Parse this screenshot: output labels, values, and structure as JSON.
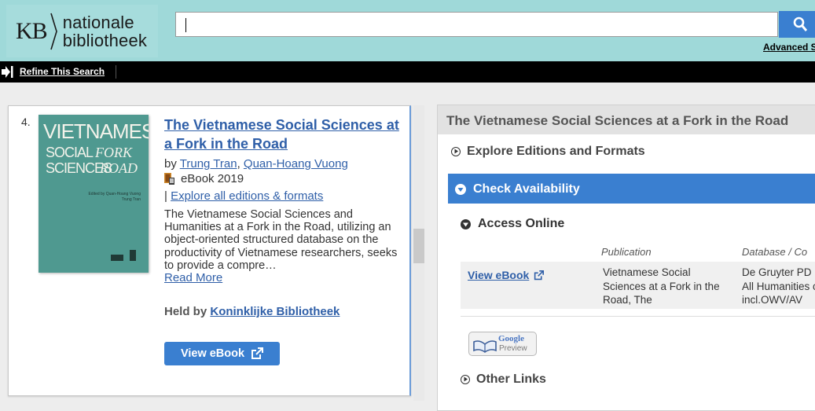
{
  "header": {
    "logo": {
      "kb": "KB",
      "line1": "nationale",
      "line2": "bibliotheek"
    },
    "search": {
      "value": "",
      "button_icon": "search-icon"
    },
    "advanced_search": "Advanced S"
  },
  "refine_bar": {
    "icon": "refine-arrow-icon",
    "label": "Refine This Search"
  },
  "record": {
    "number": "4.",
    "cover": {
      "line1": "VIETNAMESE",
      "line2": "SOCIAL",
      "line3": "SCIENCES",
      "fork": "FORK",
      "road": "ROAD",
      "small_text": "Edited by Quan-Hoang Vuong Trung Tran"
    },
    "title": "The Vietnamese Social Sciences at a Fork in the Road",
    "by_label": "by",
    "authors": [
      "Trung Tran",
      "Quan-Hoang Vuong"
    ],
    "author_sep": ",",
    "format": "eBook 2019",
    "format_icon": "ebook-icon",
    "explore_prefix": "|",
    "explore_link": "Explore all editions & formats",
    "summary": "The Vietnamese Social Sciences and Humanities at a Fork in the Road, utilizing an object-oriented structured database on the productivity of Vietnamese researchers, seeks to provide a compre…",
    "read_more": "Read More",
    "held_by_label": "Held by",
    "held_by_link": "Koninklijke Bibliotheek",
    "view_ebook": "View eBook"
  },
  "detail": {
    "title": "The Vietnamese Social Sciences at a Fork in the Road",
    "explore": "Explore Editions and Formats",
    "check_availability": "Check Availability",
    "access_online": "Access Online",
    "columns": {
      "publication": "Publication",
      "database": "Database / Co"
    },
    "row": {
      "link": "View eBook",
      "publication": "Vietnamese Social Sciences at a Fork in the Road, The",
      "database_line1": "De Gruyter PD",
      "database_line2": "All Humanities c",
      "database_line3": "incl.OWV/AV"
    },
    "google_preview": {
      "line1": "Google",
      "line2": "Preview"
    },
    "other_links": "Other Links"
  },
  "colors": {
    "accent": "#3a7fd0",
    "header_bg": "#9fd9d9",
    "link": "#2f5fa8"
  }
}
